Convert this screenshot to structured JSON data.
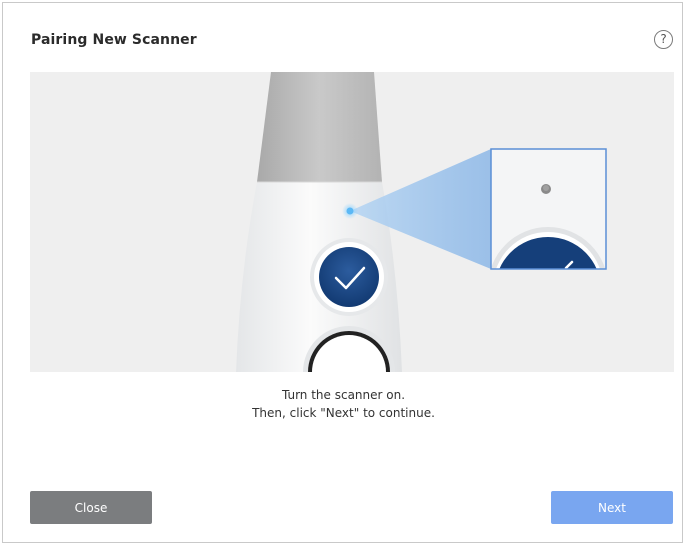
{
  "dialog": {
    "title": "Pairing New Scanner",
    "help_label": "?",
    "help_icon": "question-circle-icon"
  },
  "illustration": {
    "led_color": "#5bb8f5",
    "button_color": "#1d4a8a",
    "icons": [
      "scanner-illustration",
      "checkmark-icon",
      "led-indicator-icon",
      "zoom-callout"
    ]
  },
  "instructions": {
    "line1": "Turn the scanner on.",
    "line2": "Then, click \"Next\" to continue."
  },
  "buttons": {
    "close_label": "Close",
    "next_label": "Next"
  },
  "colors": {
    "close_button": "#7b7d7f",
    "next_button": "#79a6f0",
    "illustration_bg": "#efefef"
  }
}
